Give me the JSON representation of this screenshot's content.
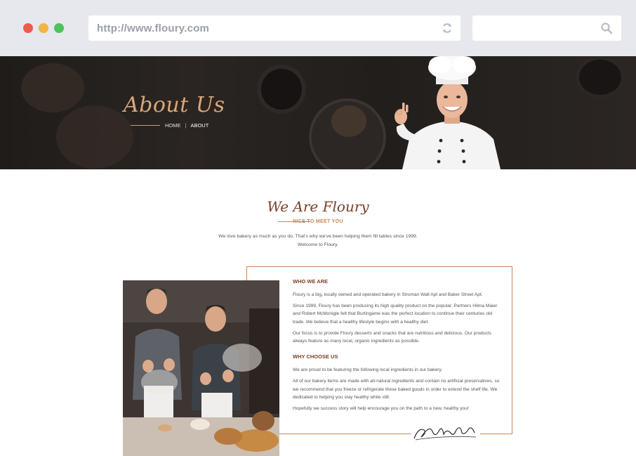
{
  "browser": {
    "url": "http://www.floury.com",
    "search_placeholder": ""
  },
  "hero": {
    "title": "About Us",
    "breadcrumb": {
      "home": "HOME",
      "separator": "|",
      "current": "ABOUT"
    }
  },
  "intro": {
    "title": "We Are Floury",
    "subtitle": "NICE TO MEET YOU",
    "text_line1": "We love bakery as much as you do. That's why we've been helping them fill tables since 1999.",
    "text_line2": "Welcome to Floury."
  },
  "who": {
    "heading": "WHO WE ARE",
    "p1": "Floury is a big, locally owned and operated bakery in Stroman Wall Apt and Baker Street Apt.",
    "p2": "Since 1999, Floury has been producing its high quality product on the popular. Partners Hilma Maier and Robert McMonigle felt that Burlingame was the perfect location to continue their centuries old trade. We believe that a healthy lifestyle begins with a healthy diet.",
    "p3": "Our focus is to provide Floury desserts and snacks that are nutritious and delicious. Our products always feature as many local, organic ingredients as possible."
  },
  "why": {
    "heading": "WHY CHOOSE US",
    "p1": "We are proud to be featuring the following local ingredients in our bakery.",
    "p2": "All of our bakery items are made with all-natural ingredients and contain no artificial preservatives, so we recommend that you freeze or refrigerate these baked goods in order to extend the shelf life. We dedicated to helping you stay healthy while still.",
    "p3": "Hopefully we success story will help encourage you on the path to a new, healthy you!"
  },
  "colors": {
    "accent": "#c8875a",
    "brown": "#7b3f26",
    "chrome": "#e6e8ee"
  },
  "icons": {
    "reload": "reload-icon",
    "search": "search-icon"
  }
}
